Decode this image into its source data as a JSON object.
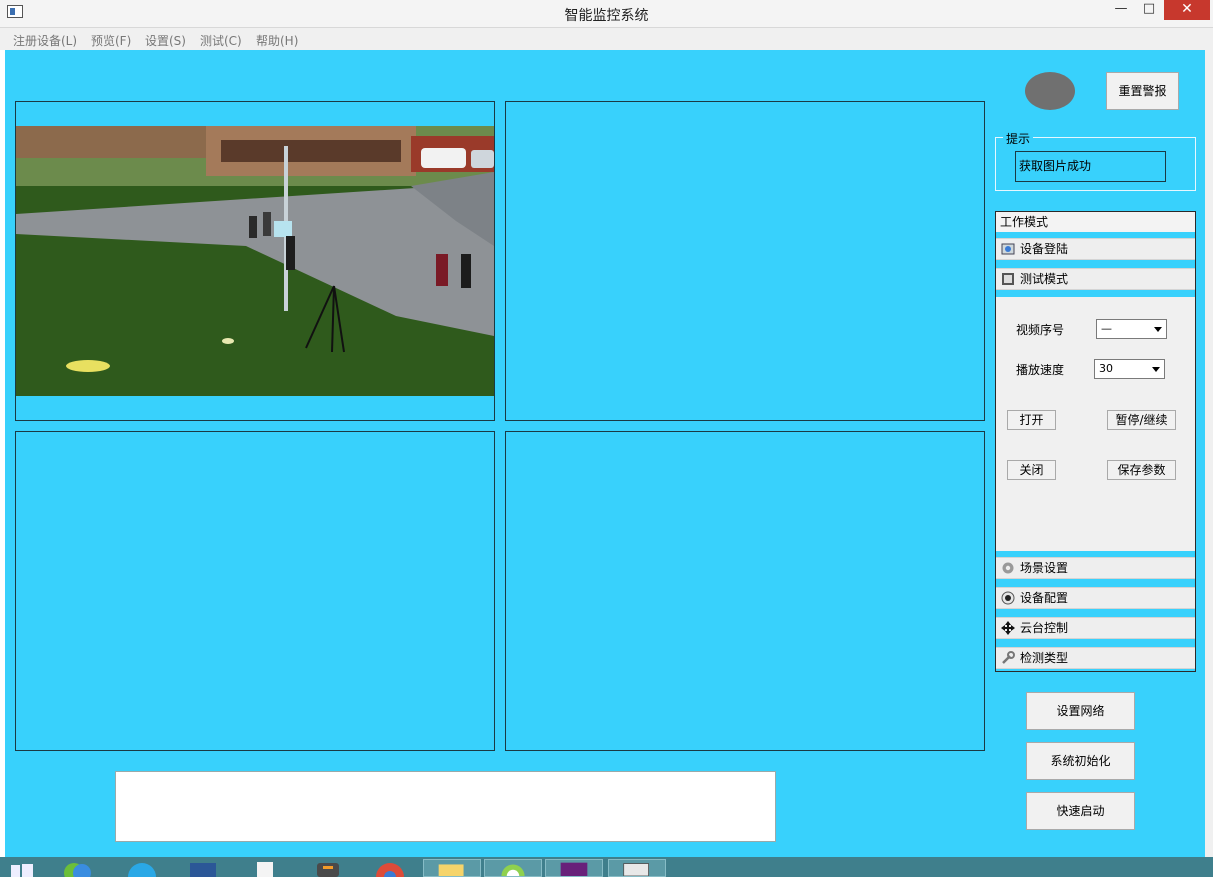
{
  "window": {
    "title": "智能监控系统",
    "minimize_glyph": "—",
    "maximize_glyph": "□",
    "close_glyph": "✕"
  },
  "menu": [
    {
      "label": "注册设备(L)"
    },
    {
      "label": "预览(F)"
    },
    {
      "label": "设置(S)"
    },
    {
      "label": "测试(C)"
    },
    {
      "label": "帮助(H)"
    }
  ],
  "alarm": {
    "indicator_color": "#707070",
    "reset_label": "重置警报"
  },
  "hint": {
    "title": "提示",
    "message": "获取图片成功"
  },
  "toolbox": {
    "header": "工作模式",
    "items": [
      {
        "label": "设备登陆",
        "icon": "login-icon"
      },
      {
        "label": "测试模式",
        "icon": "test-mode-icon"
      },
      {
        "label": "场景设置",
        "icon": "gear-icon"
      },
      {
        "label": "设备配置",
        "icon": "device-config-icon"
      },
      {
        "label": "云台控制",
        "icon": "move-arrows-icon"
      },
      {
        "label": "检测类型",
        "icon": "wrench-icon"
      }
    ]
  },
  "test_mode": {
    "video_index_label": "视频序号",
    "video_index_value": "—",
    "play_speed_label": "播放速度",
    "play_speed_value": "30",
    "open_label": "打开",
    "pause_label": "暂停/继续",
    "close_label": "关闭",
    "save_label": "保存参数"
  },
  "actions": {
    "network_label": "设置网络",
    "init_label": "系统初始化",
    "quick_start_label": "快速启动"
  },
  "colors": {
    "background": "#38d1fc",
    "panel": "#f0f0f0",
    "close_button": "#c7382d"
  }
}
